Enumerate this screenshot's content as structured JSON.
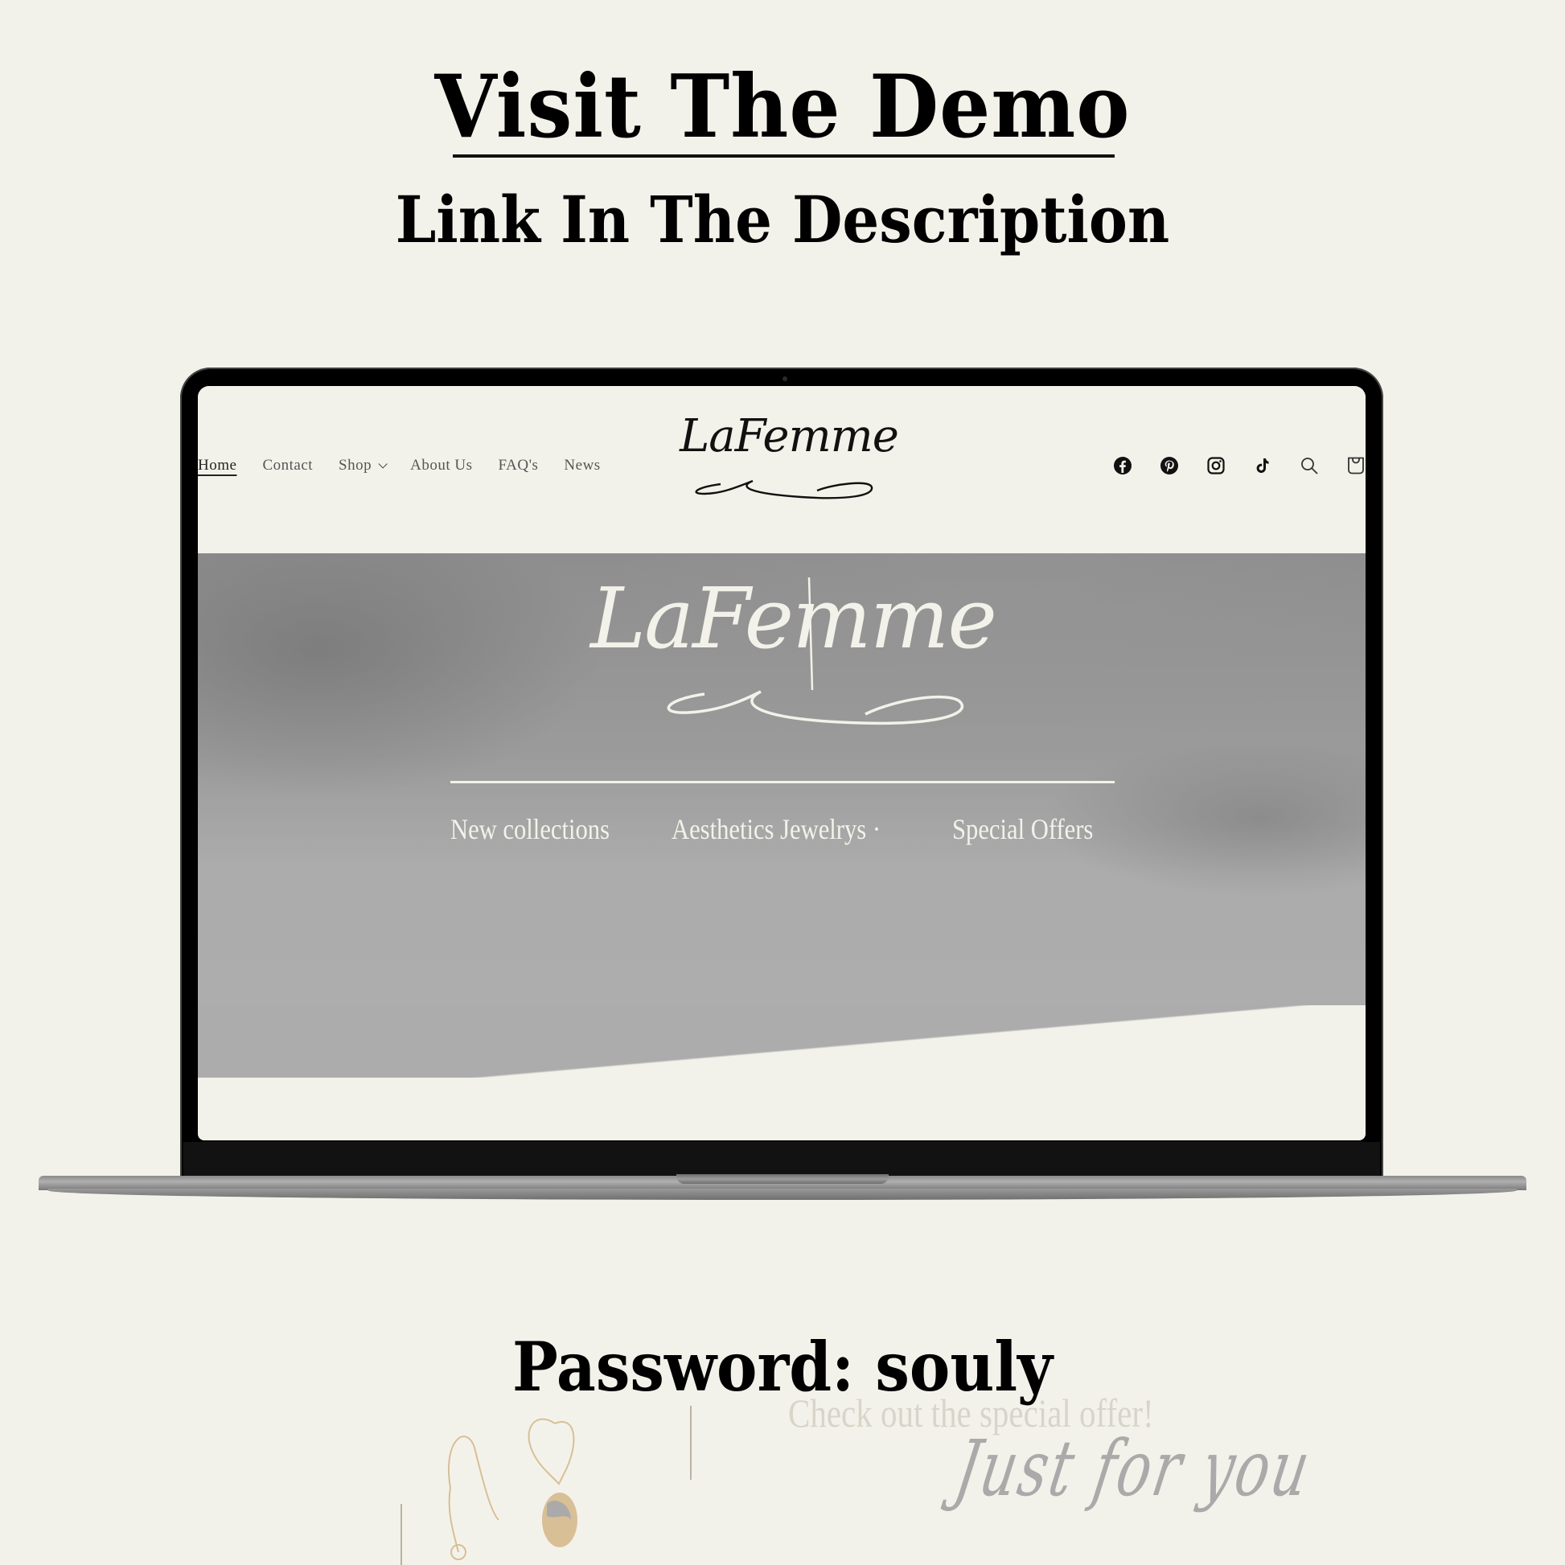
{
  "promo": {
    "title": "Visit The Demo",
    "subtitle": "Link In The Description",
    "password": "Password: souly"
  },
  "site": {
    "nav": [
      {
        "label": "Home",
        "active": true
      },
      {
        "label": "Contact"
      },
      {
        "label": "Shop",
        "has_dropdown": true
      },
      {
        "label": "About Us"
      },
      {
        "label": "FAQ's"
      },
      {
        "label": "News"
      }
    ],
    "logo": "LaFemme",
    "icons": [
      "facebook-icon",
      "pinterest-icon",
      "instagram-icon",
      "tiktok-icon",
      "search-icon",
      "cart-icon"
    ],
    "hero": {
      "logo": "LaFemme",
      "links": [
        "New collections",
        "Aesthetics Jewelrys ·",
        "Special Offers"
      ]
    }
  },
  "decor": {
    "offer": "Check out the special offer!",
    "script": "Just for you"
  },
  "colors": {
    "background": "#f3f2ea",
    "text": "#000000",
    "hero_text": "#f3f2ea",
    "hero_bg": "#9b9b9b"
  }
}
